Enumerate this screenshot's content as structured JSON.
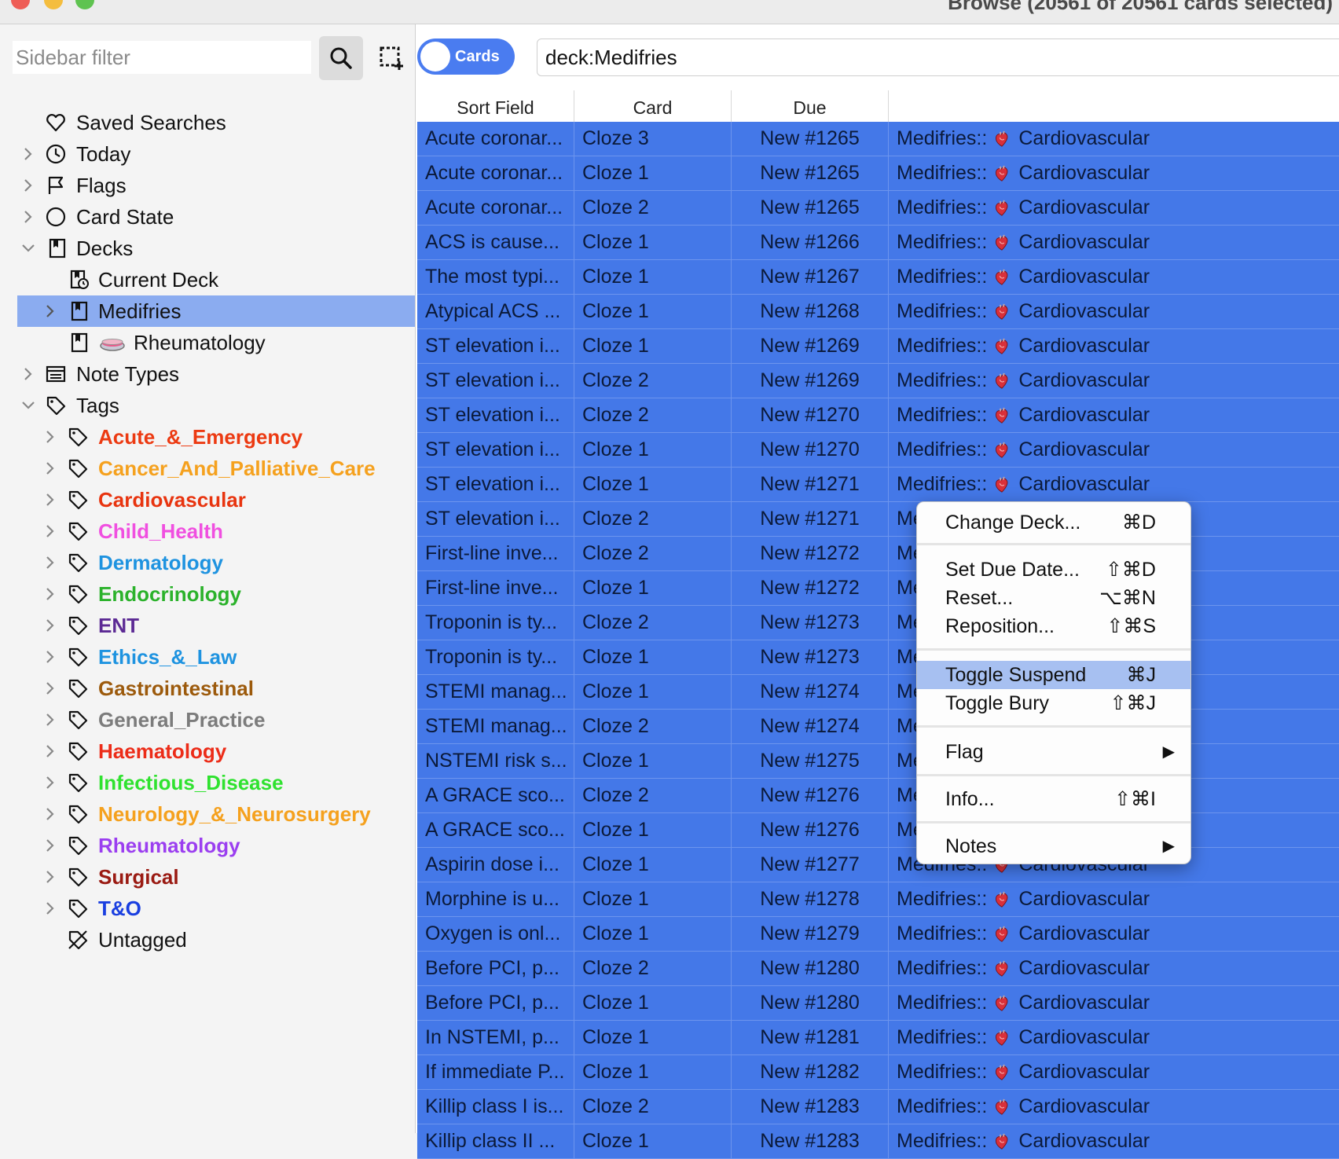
{
  "window": {
    "title": "Browse (20561 of 20561 cards selected)"
  },
  "sidebar": {
    "filter_placeholder": "Sidebar filter",
    "items": [
      {
        "label": "Saved Searches",
        "icon": "heart-outline-icon"
      },
      {
        "label": "Today",
        "icon": "clock-icon"
      },
      {
        "label": "Flags",
        "icon": "flag-icon"
      },
      {
        "label": "Card State",
        "icon": "circle-icon"
      },
      {
        "label": "Decks",
        "icon": "deck-icon"
      },
      {
        "label": "Current Deck",
        "icon": "current-deck-icon"
      },
      {
        "label": "Medifries",
        "icon": "deck-icon"
      },
      {
        "label": "Rheumatology",
        "icon": "deck-icon"
      },
      {
        "label": "Note Types",
        "icon": "note-types-icon"
      },
      {
        "label": "Tags",
        "icon": "tag-icon"
      },
      {
        "label": "Untagged",
        "icon": "untagged-icon"
      }
    ],
    "tags": [
      {
        "label": "Acute_&_Emergency",
        "color": "#ec3a12"
      },
      {
        "label": "Cancer_And_Palliative_Care",
        "color": "#f5a11e"
      },
      {
        "label": "Cardiovascular",
        "color": "#e8340f"
      },
      {
        "label": "Child_Health",
        "color": "#f04fe0"
      },
      {
        "label": "Dermatology",
        "color": "#1e93e0"
      },
      {
        "label": "Endocrinology",
        "color": "#2bb22b"
      },
      {
        "label": "ENT",
        "color": "#5c2a94"
      },
      {
        "label": "Ethics_&_Law",
        "color": "#1e93e0"
      },
      {
        "label": "Gastrointestinal",
        "color": "#9c5a0c"
      },
      {
        "label": "General_Practice",
        "color": "#7c7c7c"
      },
      {
        "label": "Haematology",
        "color": "#ec2c18"
      },
      {
        "label": "Infectious_Disease",
        "color": "#2fe22f"
      },
      {
        "label": "Neurology_&_Neurosurgery",
        "color": "#f5a11e"
      },
      {
        "label": "Rheumatology",
        "color": "#9b3ef0"
      },
      {
        "label": "Surgical",
        "color": "#9a1a12"
      },
      {
        "label": "T&O",
        "color": "#1a3fe0"
      }
    ]
  },
  "toolbar": {
    "mode_toggle": "Cards",
    "search_value": "deck:Medifries"
  },
  "table": {
    "columns": [
      "Sort Field",
      "Card",
      "Due"
    ],
    "deck_prefix": "Medifries::",
    "deck_name": "Cardiovascular",
    "rows": [
      {
        "sort": "Acute coronar...",
        "card": "Cloze 3",
        "due": "New #1265"
      },
      {
        "sort": "Acute coronar...",
        "card": "Cloze 1",
        "due": "New #1265"
      },
      {
        "sort": "Acute coronar...",
        "card": "Cloze 2",
        "due": "New #1265"
      },
      {
        "sort": "ACS is cause...",
        "card": "Cloze 1",
        "due": "New #1266"
      },
      {
        "sort": "The most typi...",
        "card": "Cloze 1",
        "due": "New #1267"
      },
      {
        "sort": "Atypical ACS ...",
        "card": "Cloze 1",
        "due": "New #1268"
      },
      {
        "sort": "ST elevation i...",
        "card": "Cloze 1",
        "due": "New #1269"
      },
      {
        "sort": "ST elevation i...",
        "card": "Cloze 2",
        "due": "New #1269"
      },
      {
        "sort": "ST elevation i...",
        "card": "Cloze 2",
        "due": "New #1270"
      },
      {
        "sort": "ST elevation i...",
        "card": "Cloze 1",
        "due": "New #1270"
      },
      {
        "sort": "ST elevation i...",
        "card": "Cloze 1",
        "due": "New #1271"
      },
      {
        "sort": "ST elevation i...",
        "card": "Cloze 2",
        "due": "New #1271"
      },
      {
        "sort": "First-line inve...",
        "card": "Cloze 2",
        "due": "New #1272"
      },
      {
        "sort": "First-line inve...",
        "card": "Cloze 1",
        "due": "New #1272"
      },
      {
        "sort": "Troponin is ty...",
        "card": "Cloze 2",
        "due": "New #1273"
      },
      {
        "sort": "Troponin is ty...",
        "card": "Cloze 1",
        "due": "New #1273"
      },
      {
        "sort": "STEMI manag...",
        "card": "Cloze 1",
        "due": "New #1274"
      },
      {
        "sort": "STEMI manag...",
        "card": "Cloze 2",
        "due": "New #1274"
      },
      {
        "sort": "NSTEMI risk s...",
        "card": "Cloze 1",
        "due": "New #1275"
      },
      {
        "sort": "A GRACE sco...",
        "card": "Cloze 2",
        "due": "New #1276"
      },
      {
        "sort": "A GRACE sco...",
        "card": "Cloze 1",
        "due": "New #1276"
      },
      {
        "sort": "Aspirin dose i...",
        "card": "Cloze 1",
        "due": "New #1277"
      },
      {
        "sort": "Morphine is u...",
        "card": "Cloze 1",
        "due": "New #1278"
      },
      {
        "sort": "Oxygen is onl...",
        "card": "Cloze 1",
        "due": "New #1279"
      },
      {
        "sort": "Before PCI, p...",
        "card": "Cloze 2",
        "due": "New #1280"
      },
      {
        "sort": "Before PCI, p...",
        "card": "Cloze 1",
        "due": "New #1280"
      },
      {
        "sort": "In NSTEMI, p...",
        "card": "Cloze 1",
        "due": "New #1281"
      },
      {
        "sort": "If immediate P...",
        "card": "Cloze 1",
        "due": "New #1282"
      },
      {
        "sort": "Killip class I is...",
        "card": "Cloze 2",
        "due": "New #1283"
      },
      {
        "sort": "Killip class II ...",
        "card": "Cloze 1",
        "due": "New #1283"
      }
    ]
  },
  "context_menu": {
    "items": [
      {
        "label": "Change Deck...",
        "shortcut": "⌘D"
      },
      {
        "label": "Set Due Date...",
        "shortcut": "⇧⌘D"
      },
      {
        "label": "Reset...",
        "shortcut": "⌥⌘N"
      },
      {
        "label": "Reposition...",
        "shortcut": "⇧⌘S"
      },
      {
        "label": "Toggle Suspend",
        "shortcut": "⌘J"
      },
      {
        "label": "Toggle Bury",
        "shortcut": "⇧⌘J"
      },
      {
        "label": "Flag",
        "shortcut": ""
      },
      {
        "label": "Info...",
        "shortcut": "⇧⌘I"
      },
      {
        "label": "Notes",
        "shortcut": ""
      }
    ],
    "submenu_arrow": "▶"
  },
  "colors": {
    "selection": "#4478e8",
    "sidebar_selection": "#8bacf0",
    "menu_highlight": "#a7c0f1",
    "accent": "#4a7cf0"
  }
}
